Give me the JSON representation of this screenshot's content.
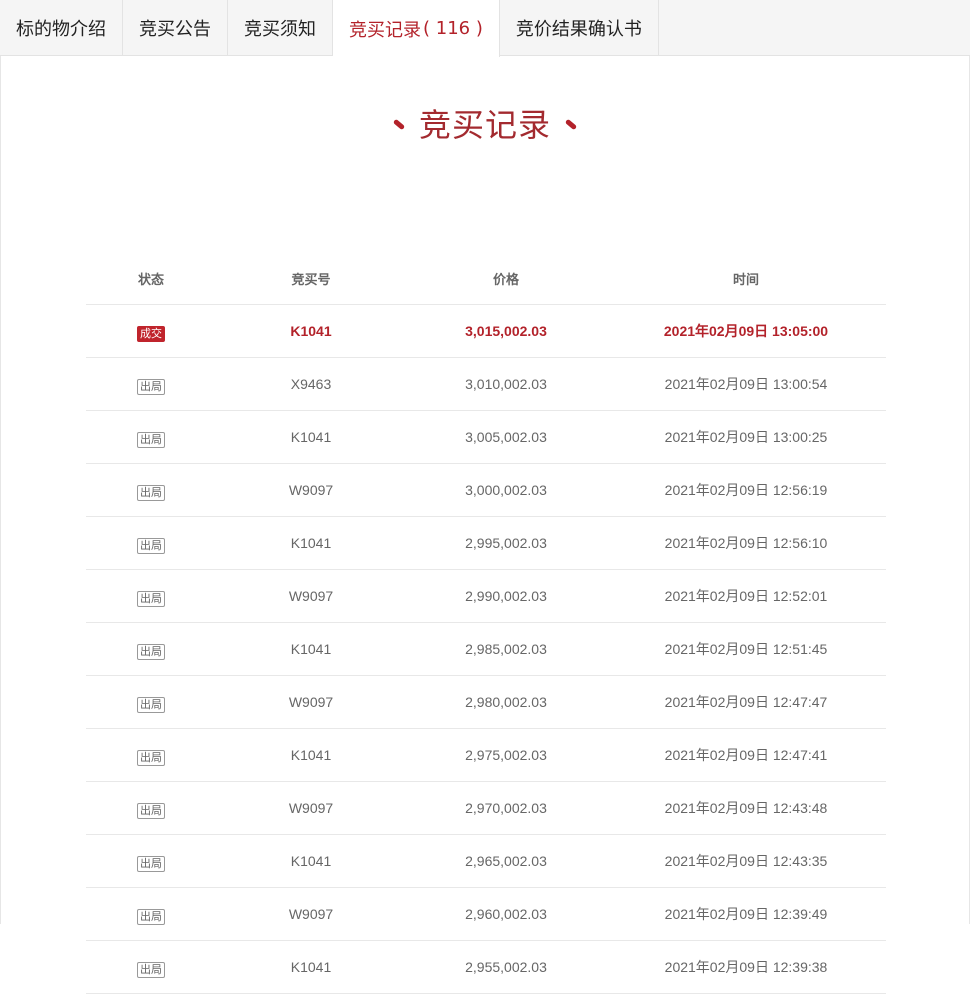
{
  "tabs": [
    {
      "label": "标的物介绍",
      "count": ""
    },
    {
      "label": "竞买公告",
      "count": ""
    },
    {
      "label": "竞买须知",
      "count": ""
    },
    {
      "label": "竞买记录",
      "count": "( 116 )"
    },
    {
      "label": "竞价结果确认书",
      "count": ""
    }
  ],
  "section_title": "竞买记录",
  "table": {
    "headers": {
      "status": "状态",
      "bid_no": "竞买号",
      "price": "价格",
      "time": "时间"
    },
    "rows": [
      {
        "status": "成交",
        "bid_no": "K1041",
        "price": "3,015,002.03",
        "time": "2021年02月09日 13:05:00"
      },
      {
        "status": "出局",
        "bid_no": "X9463",
        "price": "3,010,002.03",
        "time": "2021年02月09日 13:00:54"
      },
      {
        "status": "出局",
        "bid_no": "K1041",
        "price": "3,005,002.03",
        "time": "2021年02月09日 13:00:25"
      },
      {
        "status": "出局",
        "bid_no": "W9097",
        "price": "3,000,002.03",
        "time": "2021年02月09日 12:56:19"
      },
      {
        "status": "出局",
        "bid_no": "K1041",
        "price": "2,995,002.03",
        "time": "2021年02月09日 12:56:10"
      },
      {
        "status": "出局",
        "bid_no": "W9097",
        "price": "2,990,002.03",
        "time": "2021年02月09日 12:52:01"
      },
      {
        "status": "出局",
        "bid_no": "K1041",
        "price": "2,985,002.03",
        "time": "2021年02月09日 12:51:45"
      },
      {
        "status": "出局",
        "bid_no": "W9097",
        "price": "2,980,002.03",
        "time": "2021年02月09日 12:47:47"
      },
      {
        "status": "出局",
        "bid_no": "K1041",
        "price": "2,975,002.03",
        "time": "2021年02月09日 12:47:41"
      },
      {
        "status": "出局",
        "bid_no": "W9097",
        "price": "2,970,002.03",
        "time": "2021年02月09日 12:43:48"
      },
      {
        "status": "出局",
        "bid_no": "K1041",
        "price": "2,965,002.03",
        "time": "2021年02月09日 12:43:35"
      },
      {
        "status": "出局",
        "bid_no": "W9097",
        "price": "2,960,002.03",
        "time": "2021年02月09日 12:39:49"
      },
      {
        "status": "出局",
        "bid_no": "K1041",
        "price": "2,955,002.03",
        "time": "2021年02月09日 12:39:38"
      }
    ]
  },
  "colors": {
    "accent": "#b3222a",
    "title": "#a32a2f"
  }
}
